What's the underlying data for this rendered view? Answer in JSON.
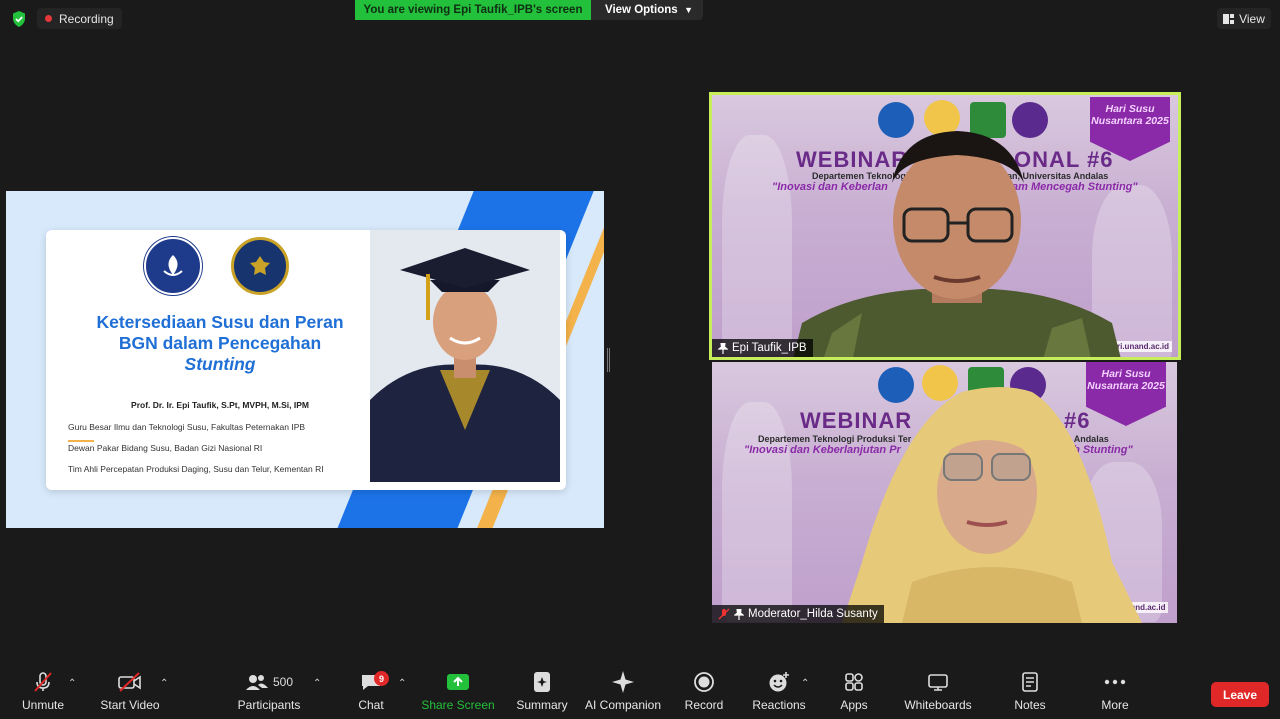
{
  "top_bar": {
    "recording_label": "Recording",
    "viewing_banner": "You are viewing Epi Taufik_IPB's screen",
    "view_options_label": "View Options",
    "view_label": "View"
  },
  "slide": {
    "title_line1": "Ketersediaan Susu dan Peran",
    "title_line2": "BGN dalam Pencegahan",
    "title_line3": "Stunting",
    "presenter": "Prof. Dr. Ir. Epi Taufik, S.Pt, MVPH, M.Si, IPM",
    "roles": [
      "Guru Besar Ilmu dan Teknologi Susu, Fakultas Peternakan IPB",
      "Dewan Pakar Bidang Susu, Badan Gizi Nasional RI",
      "Tim Ahli Percepatan Produksi Daging, Susu dan Telur, Kementan RI"
    ]
  },
  "tiles": [
    {
      "name": "Epi Taufik_IPB",
      "webinar_title_left": "WEBINAR",
      "webinar_title_right": "ONAL #6",
      "sub_left": "Departemen Teknologi P",
      "sub_right": "kan, Universitas Andalas",
      "tag_left": "\"Inovasi dan Keberlan",
      "tag_right": "am Mencegah Stunting\"",
      "badge": "Hari Susu Nusantara 2025",
      "url": "ri.unand.ac.id"
    },
    {
      "name": "Moderator_Hilda Susanty",
      "webinar_title_left": "WEBINAR",
      "webinar_title_right": "AL #6",
      "sub_left": "Departemen Teknologi Produksi Ter",
      "sub_right": ", Universitas Andalas",
      "tag_left": "\"Inovasi dan Keberlanjutan Pr",
      "tag_right": "Mencegah Stunting\"",
      "badge": "Hari Susu Nusantara 2025",
      "url": "unand.ac.id"
    }
  ],
  "toolbar": {
    "unmute": "Unmute",
    "start_video": "Start Video",
    "participants": "Participants",
    "participants_count": "500",
    "chat": "Chat",
    "chat_badge": "9",
    "share_screen": "Share Screen",
    "summary": "Summary",
    "ai_companion": "AI Companion",
    "record": "Record",
    "reactions": "Reactions",
    "apps": "Apps",
    "whiteboards": "Whiteboards",
    "notes": "Notes",
    "more": "More",
    "leave": "Leave"
  },
  "colors": {
    "share_green": "#23c03c",
    "leave_red": "#e02828",
    "active_speaker": "#c7ef5c",
    "slide_blue": "#1f6fd6"
  }
}
